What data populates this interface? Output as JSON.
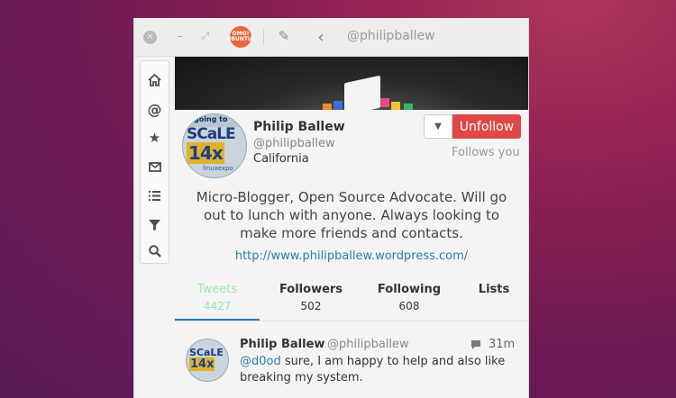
{
  "titlebar": {
    "title": "@philipballew",
    "avatar_text": "OMG! UBUNTU!",
    "icons": [
      "close-icon",
      "minimize-icon",
      "maximize-icon",
      "pencil-icon",
      "back-chevron-icon"
    ]
  },
  "sidebar": {
    "items": [
      {
        "name": "home",
        "icon": "home-icon"
      },
      {
        "name": "mentions",
        "icon": "at-icon"
      },
      {
        "name": "favorites",
        "icon": "star-icon"
      },
      {
        "name": "messages",
        "icon": "envelope-icon"
      },
      {
        "name": "lists",
        "icon": "list-icon"
      },
      {
        "name": "filters",
        "icon": "filter-icon"
      },
      {
        "name": "search",
        "icon": "search-icon"
      }
    ]
  },
  "profile": {
    "avatar_text": {
      "line1": "going to",
      "line2": "SCaLE",
      "line3": "14x",
      "line4": "linuxexpo"
    },
    "name": "Philip Ballew",
    "handle": "@philipballew",
    "location": "California",
    "bio": "Micro-Blogger, Open Source Advocate. Will go out to lunch with anyone. Always looking to make more friends and contacts.",
    "url": "http://www.philipballew.wordpress.com/",
    "unfollow_label": "Unfollow",
    "follows_you": "Follows you"
  },
  "stats": {
    "tweets": {
      "label": "Tweets",
      "value": "4427"
    },
    "followers": {
      "label": "Followers",
      "value": "502"
    },
    "following": {
      "label": "Following",
      "value": "608"
    },
    "lists": {
      "label": "Lists"
    }
  },
  "tweet": {
    "name": "Philip Ballew",
    "handle": "@philipballew",
    "time": "31m",
    "mention": "@d0od",
    "text": " sure, I am happy to help and also like breaking my system."
  },
  "colors": {
    "accent": "#2a7ab5",
    "unfollow": "#e04848"
  }
}
